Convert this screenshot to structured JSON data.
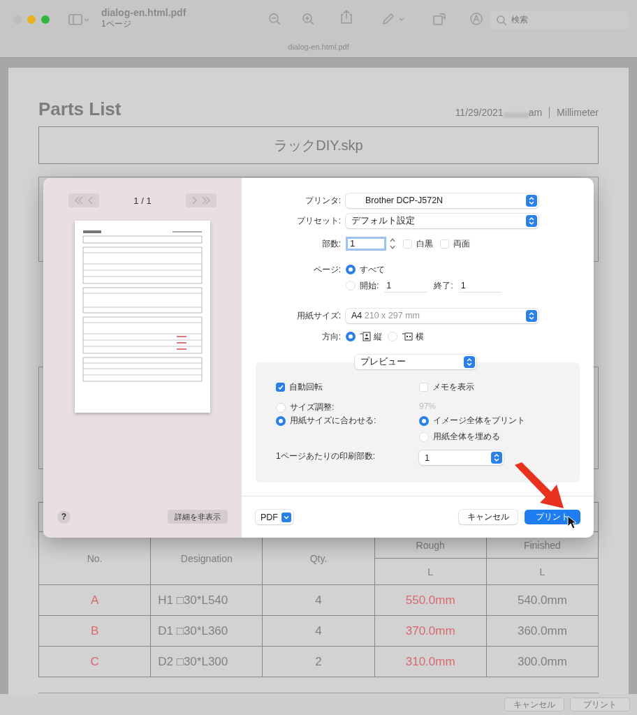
{
  "window": {
    "title": "dialog-en.html.pdf",
    "subtitle": "1ページ",
    "search_placeholder": "検索",
    "tab_title": "dialog-en.html.pdf"
  },
  "document": {
    "title": "Parts List",
    "date": "11/29/2021",
    "time_suffix": "am",
    "units": "Millimeter",
    "file_name": "ラックDIY.skp",
    "table": {
      "headers": {
        "no": "No.",
        "designation": "Designation",
        "qty": "Qty.",
        "rough": "Rough",
        "finished": "Finished",
        "rough_sub": "L",
        "finished_sub": "L"
      },
      "rows": [
        {
          "no": "A",
          "designation": "H1 □30*L540",
          "qty": "4",
          "rough": "550.0mm",
          "finished": "540.0mm"
        },
        {
          "no": "B",
          "designation": "D1 □30*L360",
          "qty": "4",
          "rough": "370.0mm",
          "finished": "360.0mm"
        },
        {
          "no": "C",
          "designation": "D2 □30*L300",
          "qty": "2",
          "rough": "310.0mm",
          "finished": "300.0mm"
        }
      ]
    }
  },
  "print_dialog": {
    "page_counter": "1 / 1",
    "help": "?",
    "hide_details": "詳細を非表示",
    "printer": {
      "label": "プリンタ:",
      "value": "Brother DCP-J572N"
    },
    "preset": {
      "label": "プリセット:",
      "value": "デフォルト設定"
    },
    "copies": {
      "label": "部数:",
      "value": "1",
      "options": [
        {
          "label": "白黒",
          "checked": false
        },
        {
          "label": "両面",
          "checked": false
        }
      ]
    },
    "pages": {
      "label": "ページ:",
      "all": {
        "label": "すべて",
        "selected": true
      },
      "range": {
        "selected": false,
        "from_label": "開始:",
        "from": "1",
        "to_label": "終了:",
        "to": "1"
      }
    },
    "paper_size": {
      "label": "用紙サイズ:",
      "size": "A4",
      "dimensions": "210 x 297 mm"
    },
    "orientation": {
      "label": "方向:",
      "options": [
        {
          "label": "縦",
          "kind": "portrait",
          "selected": true
        },
        {
          "label": "横",
          "kind": "landscape",
          "selected": false
        }
      ]
    },
    "section": "プレビュー",
    "preview_options": {
      "auto_rotate": {
        "label": "自動回転",
        "checked": true
      },
      "show_notes": {
        "label": "メモを表示",
        "checked": false
      },
      "scale": {
        "label": "サイズ調整:",
        "selected": false,
        "value": "97%"
      },
      "fit": {
        "label": "用紙サイズに合わせる:",
        "selected": true
      },
      "fit_modes": [
        {
          "label": "イメージ全体をプリント",
          "selected": true
        },
        {
          "label": "用紙全体を埋める",
          "selected": false
        }
      ],
      "copies_per_page": {
        "label": "1ページあたりの印刷部数:",
        "value": "1"
      }
    },
    "pdf": "PDF",
    "cancel": "キャンセル",
    "print": "プリント"
  },
  "sheet_buttons": [
    "キャンセル",
    "プリント"
  ]
}
